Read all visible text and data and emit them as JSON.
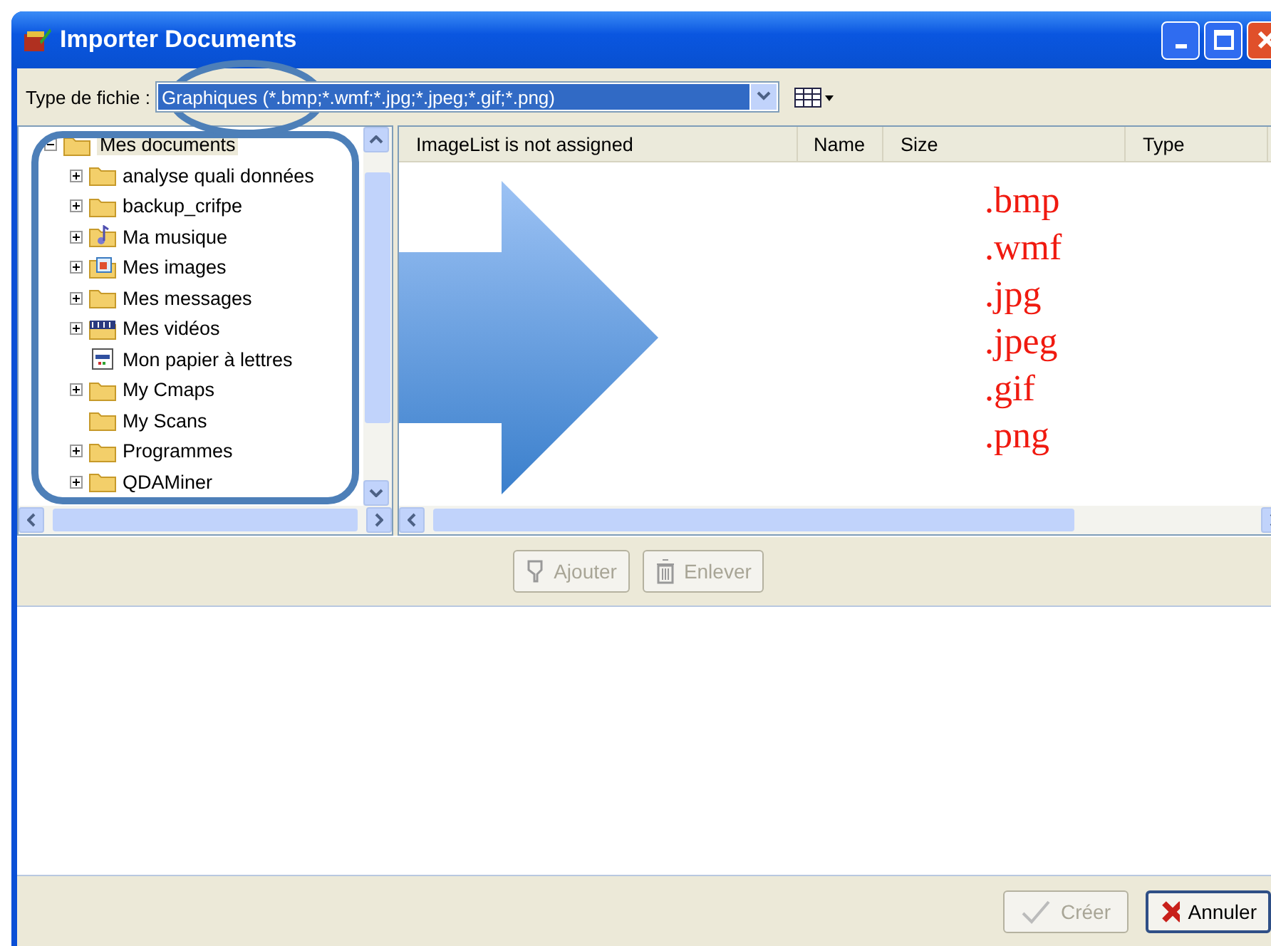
{
  "window": {
    "title": "Importer Documents"
  },
  "filter": {
    "label": "Type de fichie :",
    "value": "Graphiques (*.bmp;*.wmf;*.jpg;*.jpeg;*.gif;*.png)"
  },
  "tree": {
    "label": "Mes documents",
    "kind": "folder",
    "expanded": true,
    "children": [
      {
        "label": "analyse quali données",
        "kind": "folder",
        "expandable": true
      },
      {
        "label": "backup_crifpe",
        "kind": "folder",
        "expandable": true
      },
      {
        "label": "Ma musique",
        "kind": "music",
        "expandable": true
      },
      {
        "label": "Mes images",
        "kind": "images",
        "expandable": true
      },
      {
        "label": "Mes messages",
        "kind": "folder",
        "expandable": true
      },
      {
        "label": "Mes vidéos",
        "kind": "video",
        "expandable": true
      },
      {
        "label": "Mon papier à lettres",
        "kind": "stationery",
        "expandable": false
      },
      {
        "label": "My Cmaps",
        "kind": "folder",
        "expandable": true
      },
      {
        "label": "My Scans",
        "kind": "folder",
        "expandable": false
      },
      {
        "label": "Programmes",
        "kind": "folder",
        "expandable": true
      },
      {
        "label": "QDAMiner",
        "kind": "folder",
        "expandable": true
      }
    ]
  },
  "file_list": {
    "columns": [
      "ImageList is not assigned",
      "Name",
      "Size",
      "Type"
    ]
  },
  "extensions": [
    ".bmp",
    ".wmf",
    ".jpg",
    ".jpeg",
    ".gif",
    ".png"
  ],
  "list_buttons": [
    {
      "label": "Ajouter",
      "kind": "add",
      "disabled": true
    },
    {
      "label": "Enlever",
      "kind": "remove",
      "disabled": true
    }
  ],
  "footer_buttons": [
    {
      "label": "Créer",
      "kind": "create",
      "disabled": true
    },
    {
      "label": "Annuler",
      "kind": "cancel",
      "disabled": false
    }
  ]
}
